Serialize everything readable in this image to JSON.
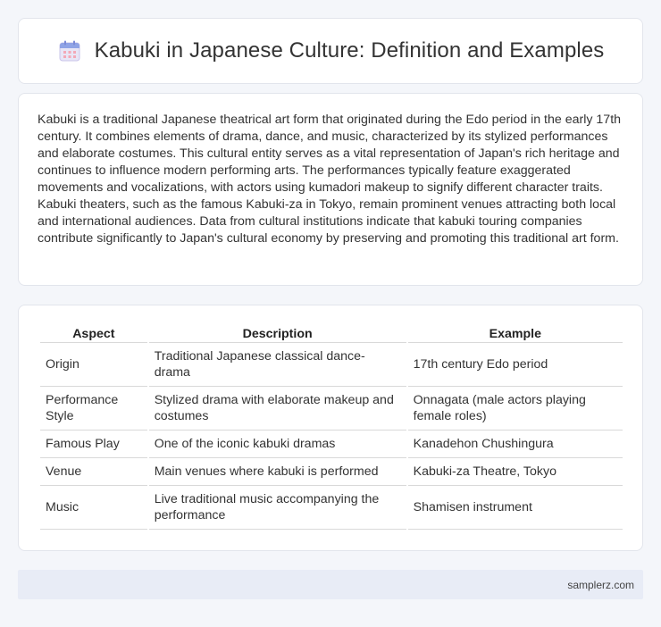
{
  "header": {
    "icon": "calendar-icon",
    "title": "Kabuki in Japanese Culture: Definition and Examples"
  },
  "intro": {
    "text": "Kabuki is a traditional Japanese theatrical art form that originated during the Edo period in the early 17th century. It combines elements of drama, dance, and music, characterized by its stylized performances and elaborate costumes. This cultural entity serves as a vital representation of Japan's rich heritage and continues to influence modern performing arts. The performances typically feature exaggerated movements and vocalizations, with actors using kumadori makeup to signify different character traits. Kabuki theaters, such as the famous Kabuki-za in Tokyo, remain prominent venues attracting both local and international audiences. Data from cultural institutions indicate that kabuki touring companies contribute significantly to Japan's cultural economy by preserving and promoting this traditional art form."
  },
  "table": {
    "headers": [
      "Aspect",
      "Description",
      "Example"
    ],
    "rows": [
      [
        "Origin",
        "Traditional Japanese classical dance-drama",
        "17th century Edo period"
      ],
      [
        "Performance Style",
        "Stylized drama with elaborate makeup and costumes",
        "Onnagata (male actors playing female roles)"
      ],
      [
        "Famous Play",
        "One of the iconic kabuki dramas",
        "Kanadehon Chushingura"
      ],
      [
        "Venue",
        "Main venues where kabuki is performed",
        "Kabuki-za Theatre, Tokyo"
      ],
      [
        "Music",
        "Live traditional music accompanying the performance",
        "Shamisen instrument"
      ]
    ]
  },
  "footer": {
    "site": "samplerz.com"
  }
}
